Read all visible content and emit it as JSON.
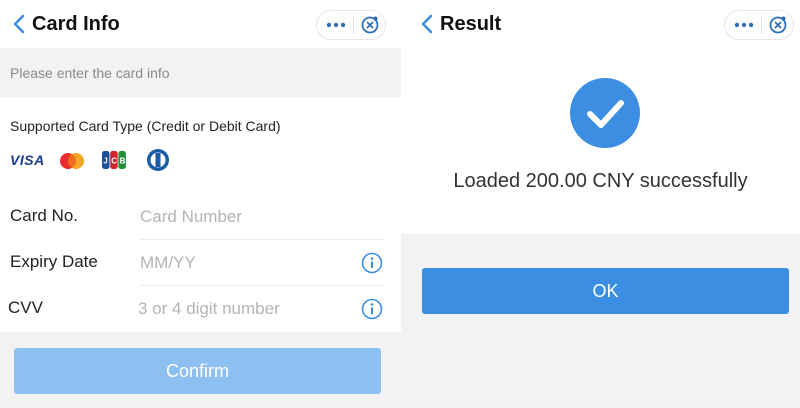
{
  "left": {
    "title": "Card Info",
    "hint": "Please enter the card info",
    "supported_label": "Supported Card Type (Credit or Debit Card)",
    "brands": [
      {
        "name": "VISA",
        "icon": "visa-logo"
      },
      {
        "icon": "mastercard-logo"
      },
      {
        "icon": "jcb-logo"
      },
      {
        "icon": "diners-club-logo"
      }
    ],
    "fields": [
      {
        "label": "Card No.",
        "placeholder": "Card Number",
        "value": ""
      },
      {
        "label": "Expiry Date",
        "placeholder": "MM/YY",
        "value": "",
        "info_icon": "info-icon"
      },
      {
        "label": "CVV",
        "placeholder": "3 or 4 digit number",
        "value": "",
        "info_icon": "info-icon"
      }
    ],
    "confirm_label": "Confirm"
  },
  "right": {
    "title": "Result",
    "message": "Loaded 200.00 CNY successfully",
    "ok_label": "OK"
  },
  "colors": {
    "accent": "#3b8ee2",
    "confirm_disabled": "#8dc0f0",
    "background": "#f2f2f2",
    "info_icon": "#3b8ee2"
  }
}
